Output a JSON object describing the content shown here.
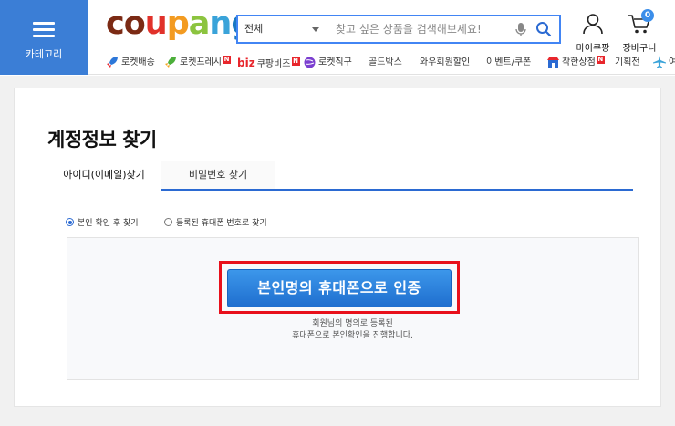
{
  "header": {
    "category_label": "카테고리",
    "logo": {
      "letters": [
        "c",
        "o",
        "u",
        "p",
        "a",
        "n",
        "g"
      ],
      "colors": [
        "#7b2a14",
        "#7b2a14",
        "#e1312a",
        "#f39b21",
        "#8cc43f",
        "#3aa3d9",
        "#1a78c2"
      ]
    },
    "search": {
      "category": "전체",
      "placeholder": "찾고 싶은 상품을 검색해보세요!"
    },
    "mycoupang_label": "마이쿠팡",
    "cart_label": "장바구니",
    "cart_count": "0",
    "accent": "#4285f4"
  },
  "nav": {
    "items": [
      {
        "label": "로켓배송",
        "icon": "rocket-icon"
      },
      {
        "label": "로켓프레시",
        "icon": "green-rocket-icon",
        "badge": "N"
      },
      {
        "label": "쿠팡비즈",
        "prefix": "biz",
        "badge": "N"
      },
      {
        "label": "로켓직구",
        "icon": "globe-icon"
      },
      {
        "label": "골드박스"
      },
      {
        "label": "와우회원할인"
      },
      {
        "label": "이벤트/쿠폰"
      },
      {
        "label": "착한상점",
        "icon": "shop-icon",
        "badge": "N"
      },
      {
        "label": "기획전"
      },
      {
        "label": "여",
        "icon": "plane-icon"
      }
    ]
  },
  "page": {
    "title": "계정정보 찾기",
    "tabs": [
      "아이디(이메일)찾기",
      "비밀번호 찾기"
    ],
    "radios": [
      "본인 확인 후 찾기",
      "등록된 휴대폰 번호로 찾기"
    ],
    "verify_button": "본인명의 휴대폰으로 인증",
    "desc_line1": "회원님의 명의로 등록된",
    "desc_line2": "휴대폰으로 본인확인을 진행합니다."
  }
}
